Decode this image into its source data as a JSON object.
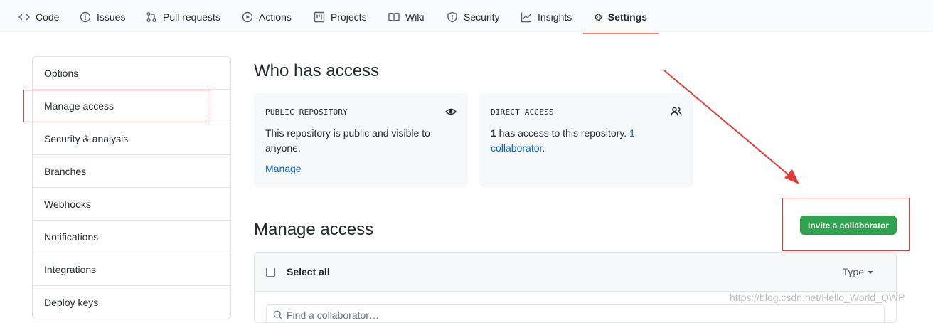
{
  "nav": {
    "tabs": [
      {
        "label": "Code",
        "icon": "code-icon"
      },
      {
        "label": "Issues",
        "icon": "issue-icon"
      },
      {
        "label": "Pull requests",
        "icon": "pull-request-icon"
      },
      {
        "label": "Actions",
        "icon": "play-icon"
      },
      {
        "label": "Projects",
        "icon": "project-icon"
      },
      {
        "label": "Wiki",
        "icon": "book-icon"
      },
      {
        "label": "Security",
        "icon": "shield-icon"
      },
      {
        "label": "Insights",
        "icon": "graph-icon"
      },
      {
        "label": "Settings",
        "icon": "gear-icon",
        "selected": true
      }
    ],
    "accent": "#f9826c"
  },
  "sidebar": {
    "items": [
      {
        "label": "Options"
      },
      {
        "label": "Manage access",
        "active": true
      },
      {
        "label": "Security & analysis"
      },
      {
        "label": "Branches"
      },
      {
        "label": "Webhooks"
      },
      {
        "label": "Notifications"
      },
      {
        "label": "Integrations"
      },
      {
        "label": "Deploy keys"
      }
    ]
  },
  "who_has_access": {
    "title": "Who has access",
    "public_card": {
      "heading": "PUBLIC REPOSITORY",
      "icon": "eye-icon",
      "text": "This repository is public and visible to anyone.",
      "link": "Manage"
    },
    "direct_card": {
      "heading": "DIRECT ACCESS",
      "icon": "people-icon",
      "count": "1",
      "text": " has access to this repository. ",
      "link": "1 collaborator",
      "suffix": "."
    }
  },
  "manage_access": {
    "title": "Manage access",
    "invite_button": "Invite a collaborator",
    "select_all": "Select all",
    "type_filter": "Type",
    "search_placeholder": "Find a collaborator…"
  },
  "watermark": "https://blog.csdn.net/Hello_World_QWP",
  "colors": {
    "green": "#2ea44f",
    "link": "#0366d6",
    "annotation_red": "#e53935"
  }
}
